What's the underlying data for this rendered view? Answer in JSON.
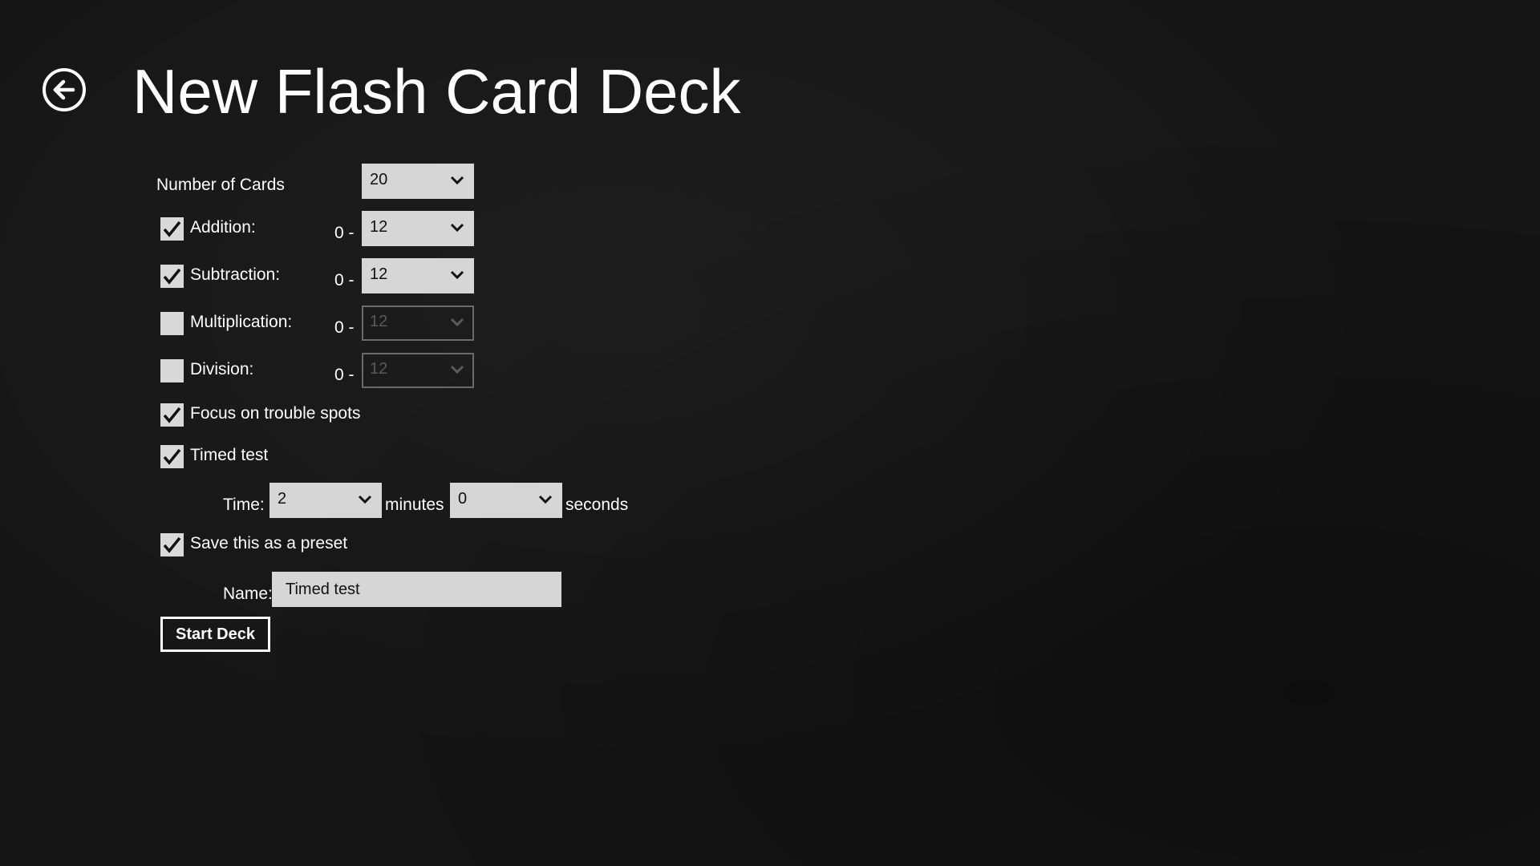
{
  "header": {
    "title": "New Flash Card Deck",
    "back_icon": "back-arrow-icon"
  },
  "number_of_cards": {
    "label": "Number of Cards",
    "value": "20"
  },
  "operations": [
    {
      "label": "Addition:",
      "checked": true,
      "range_prefix": "0 -",
      "max": "12",
      "enabled": true
    },
    {
      "label": "Subtraction:",
      "checked": true,
      "range_prefix": "0 -",
      "max": "12",
      "enabled": true
    },
    {
      "label": "Multiplication:",
      "checked": false,
      "range_prefix": "0 -",
      "max": "12",
      "enabled": false
    },
    {
      "label": "Division:",
      "checked": false,
      "range_prefix": "0 -",
      "max": "12",
      "enabled": false
    }
  ],
  "focus": {
    "label": "Focus on trouble spots",
    "checked": true
  },
  "timed": {
    "label": "Timed test",
    "checked": true,
    "time_label": "Time:",
    "minutes_value": "2",
    "minutes_label": "minutes",
    "seconds_value": "0",
    "seconds_label": "seconds"
  },
  "preset": {
    "label": "Save this as a preset",
    "checked": true,
    "name_label": "Name:",
    "name_value": "Timed test"
  },
  "start_button": "Start Deck",
  "colors": {
    "background": "#161616",
    "control_fill": "#d6d6d6",
    "checkbox_fill": "#d9d9d9",
    "text": "#ffffff"
  }
}
